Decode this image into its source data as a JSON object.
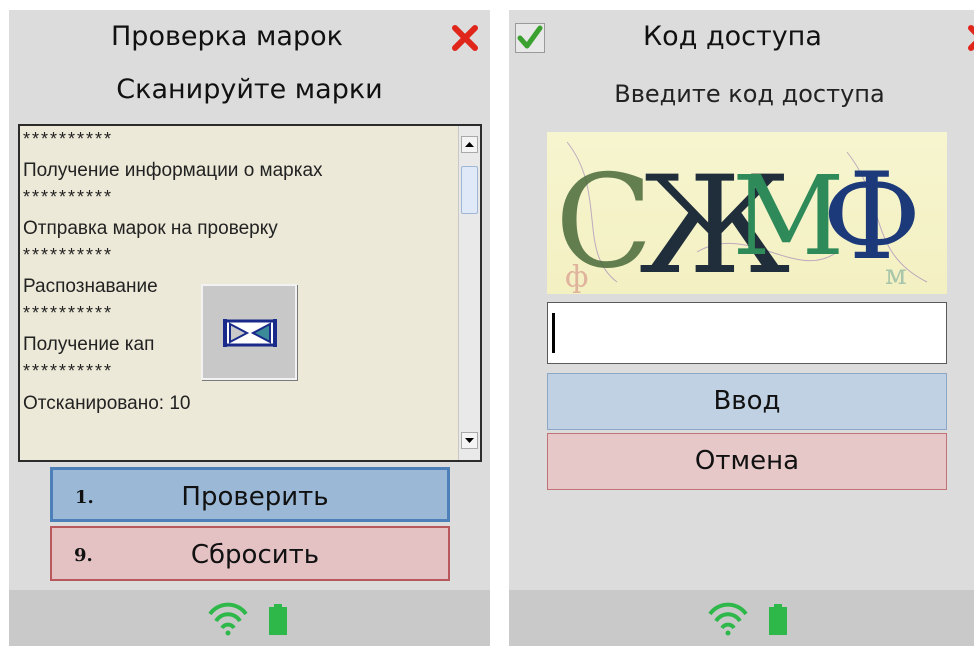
{
  "left": {
    "title": "Проверка марок",
    "subtitle": "Сканируйте марки",
    "log": [
      {
        "kind": "stars",
        "text": "**********"
      },
      {
        "kind": "msg",
        "text": "Получение информации о марках"
      },
      {
        "kind": "stars",
        "text": "**********"
      },
      {
        "kind": "msg",
        "text": "Отправка марок на проверку"
      },
      {
        "kind": "stars",
        "text": "**********"
      },
      {
        "kind": "msg",
        "text": "Распознавание"
      },
      {
        "kind": "stars",
        "text": "**********"
      },
      {
        "kind": "msg",
        "text": "Получение кап"
      },
      {
        "kind": "stars",
        "text": "**********"
      },
      {
        "kind": "final",
        "text": "Отсканировано: 10"
      }
    ],
    "buttons": {
      "check": {
        "num": "1.",
        "label": "Проверить"
      },
      "reset": {
        "num": "9.",
        "label": "Сбросить"
      }
    }
  },
  "right": {
    "title": "Код доступа",
    "subtitle": "Введите код доступа",
    "captcha_text": "СЖМФ",
    "input_value": "",
    "enter_label": "Ввод",
    "cancel_label": "Отмена"
  },
  "icons": {
    "close": "close-icon",
    "ok": "checkmark-icon",
    "wifi": "wifi-icon",
    "battery": "battery-icon",
    "busy": "hourglass-icon"
  },
  "colors": {
    "close": "#e0261b",
    "ok": "#3aa12f",
    "status_green": "#2fb84a",
    "primary_button": "#9bb9d7",
    "danger_button": "#e4c2c4"
  }
}
